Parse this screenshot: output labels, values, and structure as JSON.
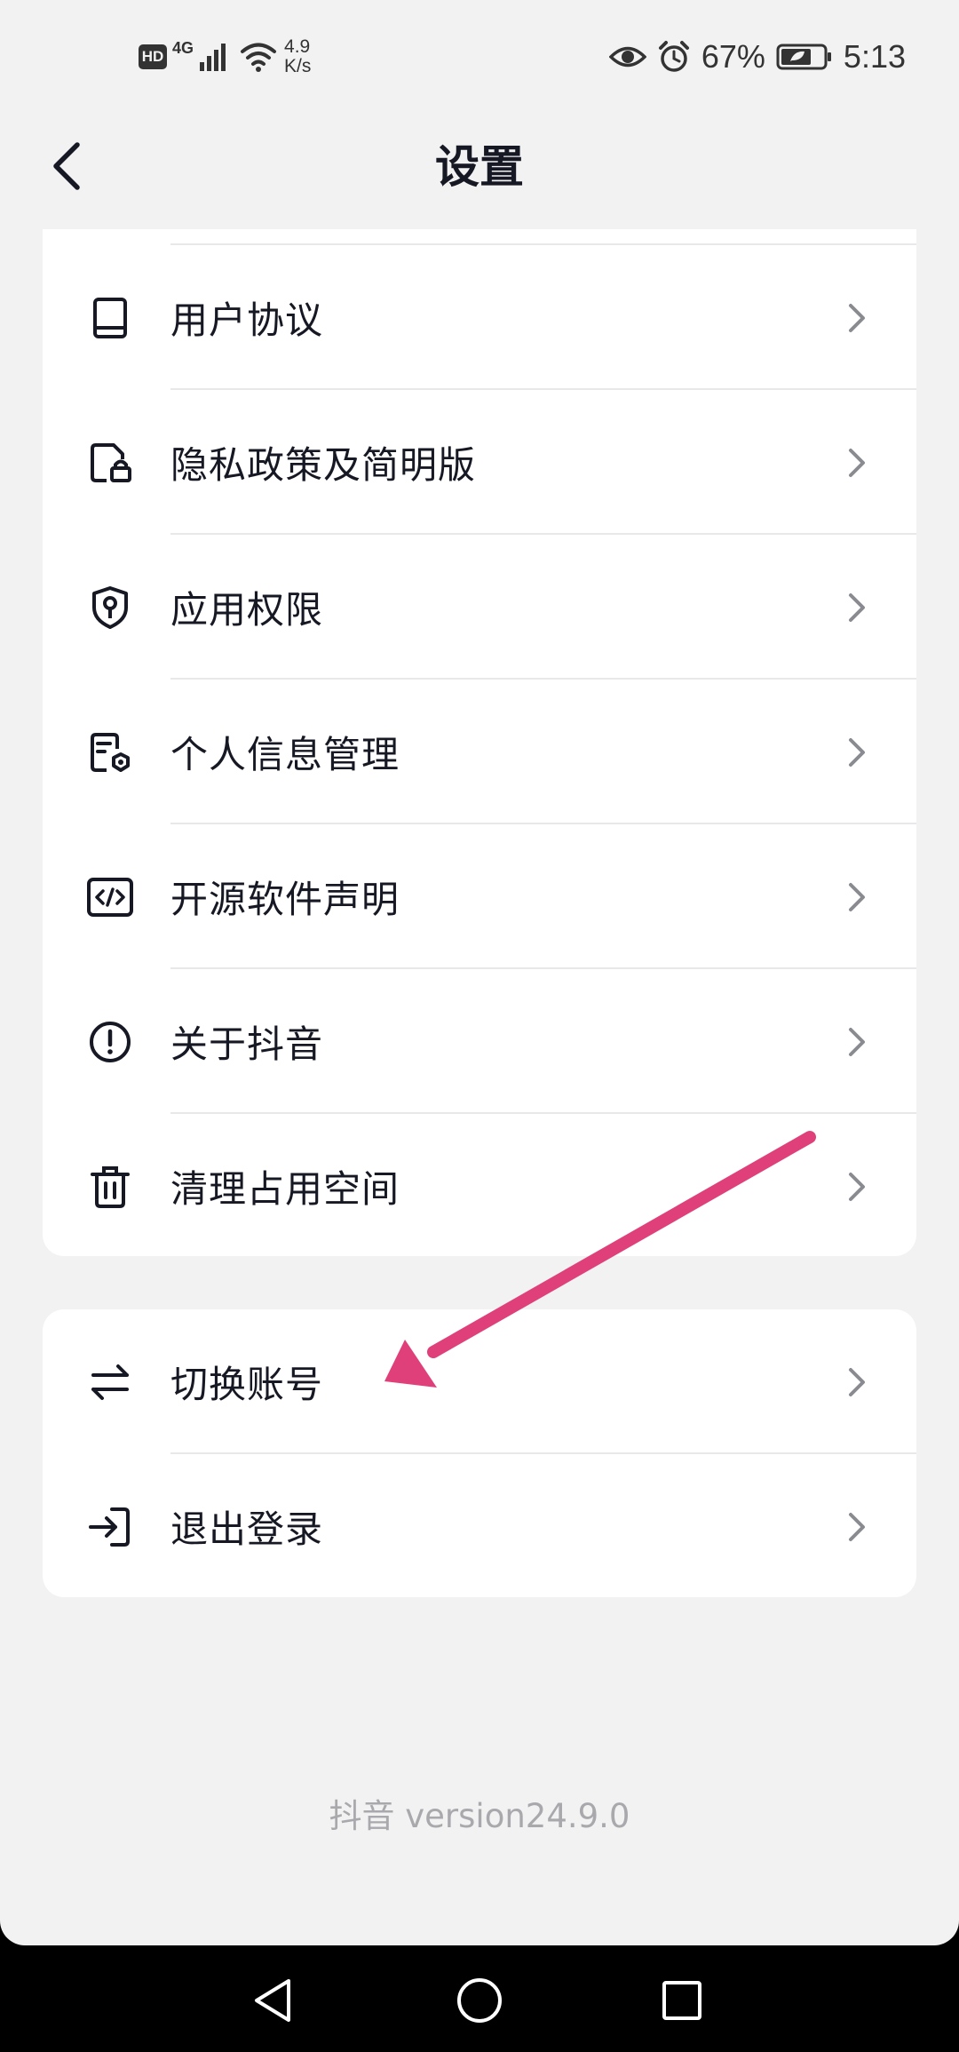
{
  "status_bar": {
    "hd": "HD",
    "network": "4G",
    "speed_value": "4.9",
    "speed_unit": "K/s",
    "battery_percent": "67%",
    "time": "5:13",
    "icons": [
      "signal-icon",
      "wifi-icon",
      "eye-icon",
      "alarm-icon",
      "battery-icon"
    ]
  },
  "header": {
    "title": "设置",
    "back_icon": "back-arrow-icon"
  },
  "settings_group_1": [
    {
      "label": "用户协议",
      "icon": "book-icon"
    },
    {
      "label": "隐私政策及简明版",
      "icon": "document-lock-icon"
    },
    {
      "label": "应用权限",
      "icon": "shield-key-icon"
    },
    {
      "label": "个人信息管理",
      "icon": "document-gear-icon"
    },
    {
      "label": "开源软件声明",
      "icon": "code-icon"
    },
    {
      "label": "关于抖音",
      "icon": "info-circle-icon"
    },
    {
      "label": "清理占用空间",
      "icon": "trash-icon"
    }
  ],
  "settings_group_2": [
    {
      "label": "切换账号",
      "icon": "switch-arrows-icon"
    },
    {
      "label": "退出登录",
      "icon": "logout-icon"
    }
  ],
  "footer": {
    "version": "抖音 version24.9.0"
  },
  "annotation": {
    "color": "#e0407a"
  },
  "nav_bar": {
    "icons": [
      "back-triangle-icon",
      "home-circle-icon",
      "recents-square-icon"
    ]
  },
  "colors": {
    "background": "#f2f2f3",
    "card": "#ffffff",
    "text_primary": "#161823",
    "text_secondary": "#a9a9ad"
  }
}
